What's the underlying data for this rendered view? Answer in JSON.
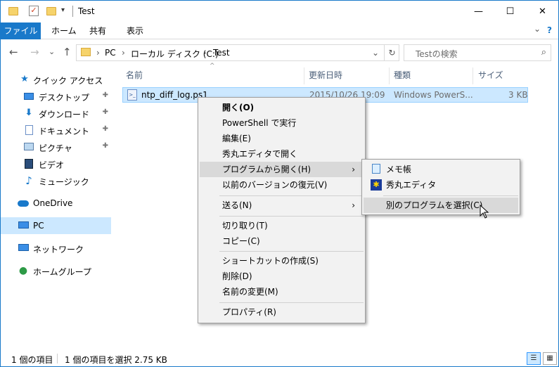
{
  "window": {
    "title": "Test",
    "minimize_glyph": "—",
    "maximize_glyph": "☐",
    "close_glyph": "✕"
  },
  "ribbon": {
    "tabs": [
      "ファイル",
      "ホーム",
      "共有",
      "表示"
    ],
    "expand_glyph": "⌄",
    "help_glyph": "?"
  },
  "nav": {
    "back": "←",
    "forward": "→",
    "recent": "⌄",
    "up": "↑",
    "breadcrumb": [
      "PC",
      "ローカル ディスク (C:)",
      "Test"
    ],
    "crumb_sep": "›",
    "dropdown_glyph": "⌄",
    "refresh_glyph": "↻",
    "search_placeholder": "Testの検索",
    "search_glyph": "⌕"
  },
  "navpane": {
    "items": [
      {
        "label": "クイック アクセス",
        "icon": "star-icon",
        "pinned": false
      },
      {
        "label": "デスクトップ",
        "icon": "desktop-icon",
        "pinned": true
      },
      {
        "label": "ダウンロード",
        "icon": "download-icon",
        "pinned": true
      },
      {
        "label": "ドキュメント",
        "icon": "documents-icon",
        "pinned": true
      },
      {
        "label": "ピクチャ",
        "icon": "pictures-icon",
        "pinned": true
      },
      {
        "label": "ビデオ",
        "icon": "videos-icon",
        "pinned": false
      },
      {
        "label": "ミュージック",
        "icon": "music-icon",
        "pinned": false
      },
      {
        "label": "OneDrive",
        "icon": "onedrive-icon",
        "pinned": false
      },
      {
        "label": "PC",
        "icon": "pc-icon",
        "pinned": false,
        "selected": true
      },
      {
        "label": "ネットワーク",
        "icon": "network-icon",
        "pinned": false
      },
      {
        "label": "ホームグループ",
        "icon": "homegroup-icon",
        "pinned": false
      }
    ],
    "pin_glyph": "📌"
  },
  "filelist": {
    "columns": [
      "名前",
      "更新日時",
      "種類",
      "サイズ"
    ],
    "sort_glyph": "^",
    "file": {
      "name": "ntp_diff_log.ps1",
      "modified": "2015/10/26 19:09",
      "type": "Windows PowerS...",
      "size": "3 KB"
    }
  },
  "context_menu": {
    "items": [
      "開く(O)",
      "PowerShell で実行",
      "編集(E)",
      "秀丸エディタで開く",
      "プログラムから開く(H)",
      "以前のバージョンの復元(V)",
      "送る(N)",
      "切り取り(T)",
      "コピー(C)",
      "ショートカットの作成(S)",
      "削除(D)",
      "名前の変更(M)",
      "プロパティ(R)"
    ],
    "submenu_glyph": "›"
  },
  "submenu": {
    "items": [
      "メモ帳",
      "秀丸エディタ",
      "別のプログラムを選択(C)"
    ]
  },
  "status": {
    "count": "1 個の項目",
    "selected": "1 個の項目を選択  2.75 KB"
  },
  "colors": {
    "accent": "#1979ca",
    "selection": "#cce8ff",
    "menu_bg": "#f2f2f2",
    "menu_highlight": "#d9d9d9"
  }
}
